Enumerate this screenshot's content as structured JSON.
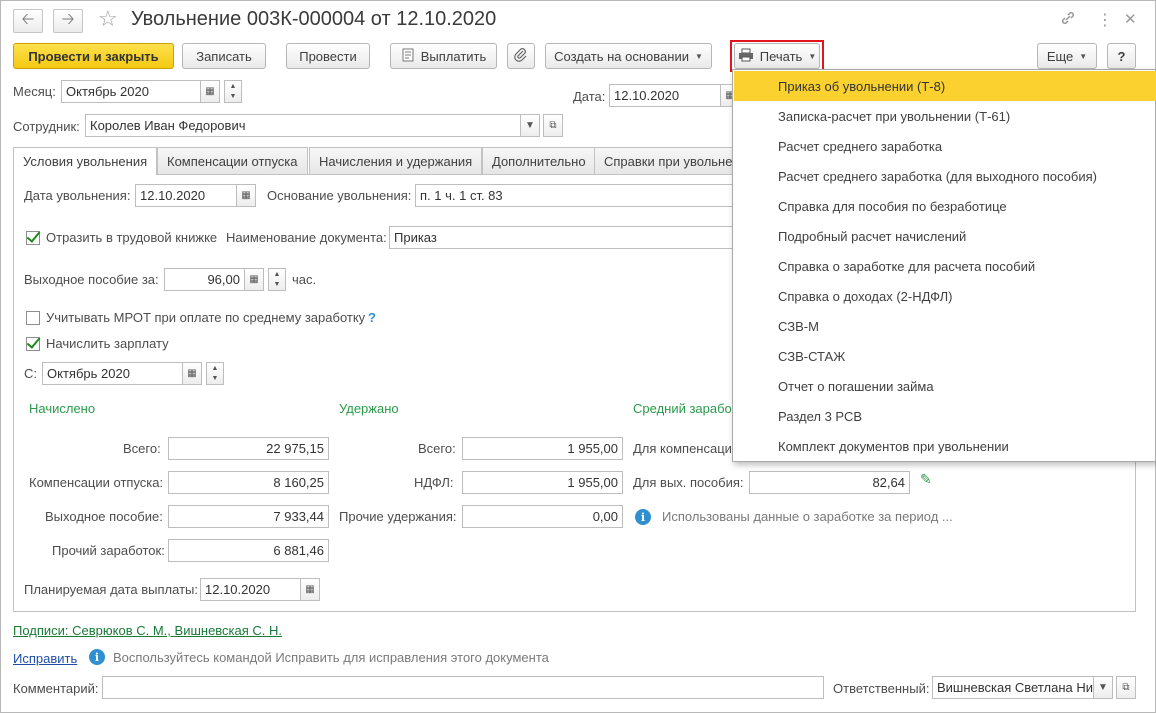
{
  "window": {
    "title": "Увольнение 003К-000004 от 12.10.2020",
    "back_icon": "arrow-left-icon",
    "forward_icon": "arrow-right-icon",
    "star_icon": "star-icon"
  },
  "toolbar": {
    "post_close": "Провести и закрыть",
    "save": "Записать",
    "post": "Провести",
    "pay": "Выплатить",
    "create_based": "Создать на основании",
    "print": "Печать",
    "more": "Еще",
    "help": "?"
  },
  "header": {
    "month_label": "Месяц:",
    "month_value": "Октябрь 2020",
    "date_label": "Дата:",
    "date_value": "12.10.2020",
    "employee_label": "Сотрудник:",
    "employee_value": "Королев Иван Федорович"
  },
  "tabs": [
    {
      "label": "Условия увольнения"
    },
    {
      "label": "Компенсации отпуска"
    },
    {
      "label": "Начисления и удержания"
    },
    {
      "label": "Дополнительно"
    },
    {
      "label": "Справки при увольне"
    }
  ],
  "conditions": {
    "dismissal_date_label": "Дата увольнения:",
    "dismissal_date_value": "12.10.2020",
    "basis_label": "Основание увольнения:",
    "basis_value": "п. 1 ч. 1 ст. 83",
    "workbook_label": "Отразить в трудовой книжке",
    "doc_name_label": "Наименование документа:",
    "doc_name_value": "Приказ",
    "severance_label": "Выходное пособие за:",
    "severance_value": "96,00",
    "severance_unit": "час.",
    "mrot_label": "Учитывать МРОТ при оплате по среднему заработку",
    "mrot_help": "?",
    "calc_salary_label": "Начислить зарплату",
    "from_label": "С:",
    "from_value": "Октябрь 2020"
  },
  "accrued": {
    "title": "Начислено",
    "total_label": "Всего:",
    "total_value": "22 975,15",
    "vacation_label": "Компенсации отпуска:",
    "vacation_value": "8 160,25",
    "severance_label": "Выходное пособие:",
    "severance_value": "7 933,44",
    "other_label": "Прочий заработок:",
    "other_value": "6 881,46"
  },
  "withheld": {
    "title": "Удержано",
    "total_label": "Всего:",
    "total_value": "1 955,00",
    "ndfl_label": "НДФЛ:",
    "ndfl_value": "1 955,00",
    "other_label": "Прочие удержания:",
    "other_value": "0,00"
  },
  "average": {
    "title": "Средний зарабо",
    "comp_label": "Для компенсаци",
    "sev_label": "Для вых. пособия:",
    "sev_value": "82,64",
    "info_text": "Использованы данные о заработке за период ..."
  },
  "planned_date_label": "Планируемая дата выплаты:",
  "planned_date_value": "12.10.2020",
  "footer": {
    "signatures_link": "Подписи: Севрюков С. М., Вишневская С. Н.",
    "fix_link": "Исправить",
    "fix_hint": "Воспользуйтесь командой Исправить для исправления этого документа",
    "comment_label": "Комментарий:",
    "comment_value": "",
    "responsible_label": "Ответственный:",
    "responsible_value": "Вишневская Светлана Ни"
  },
  "print_menu": {
    "items": [
      {
        "label": "Приказ об увольнении (Т-8)",
        "selected": true
      },
      {
        "label": "Записка-расчет при увольнении (Т-61)"
      },
      {
        "label": "Расчет среднего заработка"
      },
      {
        "label": "Расчет среднего заработка (для выходного пособия)"
      },
      {
        "label": "Справка для пособия по безработице"
      },
      {
        "label": "Подробный расчет начислений"
      },
      {
        "label": "Справка о заработке для расчета пособий"
      },
      {
        "label": "Справка о доходах (2-НДФЛ)"
      },
      {
        "label": "СЗВ-М"
      },
      {
        "label": "СЗВ-СТАЖ"
      },
      {
        "label": "Отчет о погашении займа"
      },
      {
        "label": "Раздел 3 РСВ"
      },
      {
        "label": "Комплект документов при увольнении"
      }
    ]
  },
  "colors": {
    "primary_button": "#f3c911",
    "highlight_border": "#e2141c",
    "section_green": "#2a9a4a",
    "menu_selected": "#fbd12f"
  }
}
